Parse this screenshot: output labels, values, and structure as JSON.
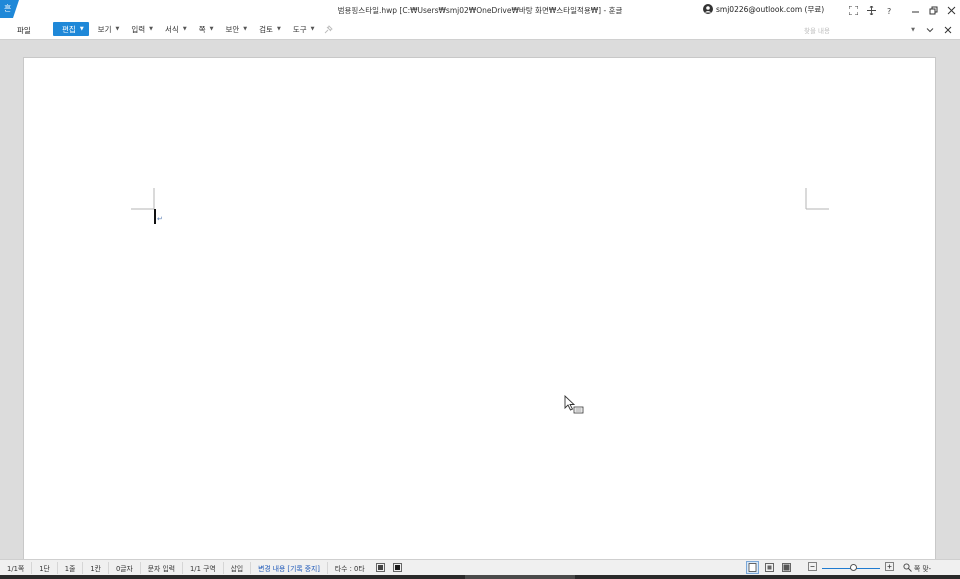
{
  "titlebar": {
    "window_title": "범용핑스타일.hwp [C:₩Users₩smj02₩OneDrive₩바탕 화면₩스타일적용₩] - 훈글",
    "account": "smj0226@outlook.com (무료)"
  },
  "menubar": {
    "file": "파일",
    "items": [
      {
        "label": "편집",
        "active": true
      },
      {
        "label": "보기"
      },
      {
        "label": "입력"
      },
      {
        "label": "서식"
      },
      {
        "label": "쪽"
      },
      {
        "label": "보안"
      },
      {
        "label": "검토"
      },
      {
        "label": "도구"
      }
    ],
    "search_placeholder": "찾을 내용"
  },
  "document": {
    "paragraph_mark": "↵"
  },
  "statusbar": {
    "page": "1/1쪽",
    "column": "1단",
    "line": "1줄",
    "col_pos": "1칸",
    "chars": "0글자",
    "input_mode": "문자 입력",
    "section": "1/1 구역",
    "insert_mode": "삽입",
    "track_changes": "변경 내용 [기록 중지]",
    "typing": "타수 : 0타",
    "zoom_label": "쪽 맞-",
    "zoom_level": 0.55
  },
  "colors": {
    "accent": "#1f88d8",
    "page_bg": "#ffffff",
    "workspace_bg": "#dcdcdc"
  }
}
